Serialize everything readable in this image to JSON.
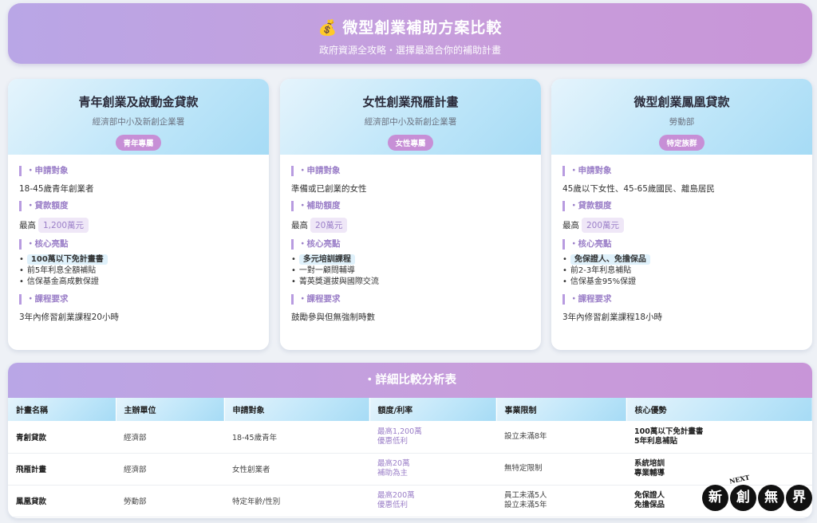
{
  "header": {
    "icon": "money-bag-icon",
    "title": "微型創業補助方案比較",
    "subtitle": "政府資源全攻略・選擇最適合你的補助計畫"
  },
  "cards": [
    {
      "title": "青年創業及啟動金貸款",
      "agency": "經濟部中小及新創企業署",
      "badge": "青年專屬",
      "sec1_label": "申請對象",
      "sec1_text": "18-45歲青年創業者",
      "sec2_label": "貸款額度",
      "sec2_prefix": "最高",
      "sec2_value": "1,200萬元",
      "sec3_label": "核心亮點",
      "highlights": [
        "100萬以下免計畫書",
        "前5年利息全額補貼",
        "信保基金高成數保證"
      ],
      "sec4_label": "課程要求",
      "sec4_text": "3年內修習創業課程20小時"
    },
    {
      "title": "女性創業飛雁計畫",
      "agency": "經濟部中小及新創企業署",
      "badge": "女性專屬",
      "sec1_label": "申請對象",
      "sec1_text": "準備或已創業的女性",
      "sec2_label": "補助額度",
      "sec2_prefix": "最高",
      "sec2_value": "20萬元",
      "sec3_label": "核心亮點",
      "highlights": [
        "多元培訓課程",
        "一對一顧問輔導",
        "菁英獎選拔與國際交流"
      ],
      "sec4_label": "課程要求",
      "sec4_text": "鼓勵參與但無強制時數"
    },
    {
      "title": "微型創業鳳凰貸款",
      "agency": "勞動部",
      "badge": "特定族群",
      "sec1_label": "申請對象",
      "sec1_text": "45歲以下女性、45-65歲國民、離島居民",
      "sec2_label": "貸款額度",
      "sec2_prefix": "最高",
      "sec2_value": "200萬元",
      "sec3_label": "核心亮點",
      "highlights": [
        "免保證人、免擔保品",
        "前2-3年利息補貼",
        "信保基金95%保證"
      ],
      "sec4_label": "課程要求",
      "sec4_text": "3年內修習創業課程18小時"
    }
  ],
  "table": {
    "title": "詳細比較分析表",
    "headers": [
      "計畫名稱",
      "主辦單位",
      "申請對象",
      "額度/利率",
      "事業限制",
      "核心優勢"
    ],
    "rows": [
      {
        "name": "青創貸款",
        "org": "經濟部",
        "target": "18-45歲青年",
        "amount1": "最高1,200萬",
        "amount2": "優惠低利",
        "limit1": "設立未滿8年",
        "limit2": "",
        "adv1": "100萬以下免計畫書",
        "adv2": "5年利息補貼"
      },
      {
        "name": "飛雁計畫",
        "org": "經濟部",
        "target": "女性創業者",
        "amount1": "最高20萬",
        "amount2": "補助為主",
        "limit1": "無特定限制",
        "limit2": "",
        "adv1": "系統培訓",
        "adv2": "專業輔導"
      },
      {
        "name": "鳳凰貸款",
        "org": "勞動部",
        "target": "特定年齡/性別",
        "amount1": "最高200萬",
        "amount2": "優惠低利",
        "limit1": "員工未滿5人",
        "limit2": "設立未滿5年",
        "adv1": "免保證人",
        "adv2": "免擔保品"
      }
    ]
  },
  "logo": {
    "next": "NEXT",
    "chars": [
      "新",
      "創",
      "無",
      "界"
    ]
  }
}
